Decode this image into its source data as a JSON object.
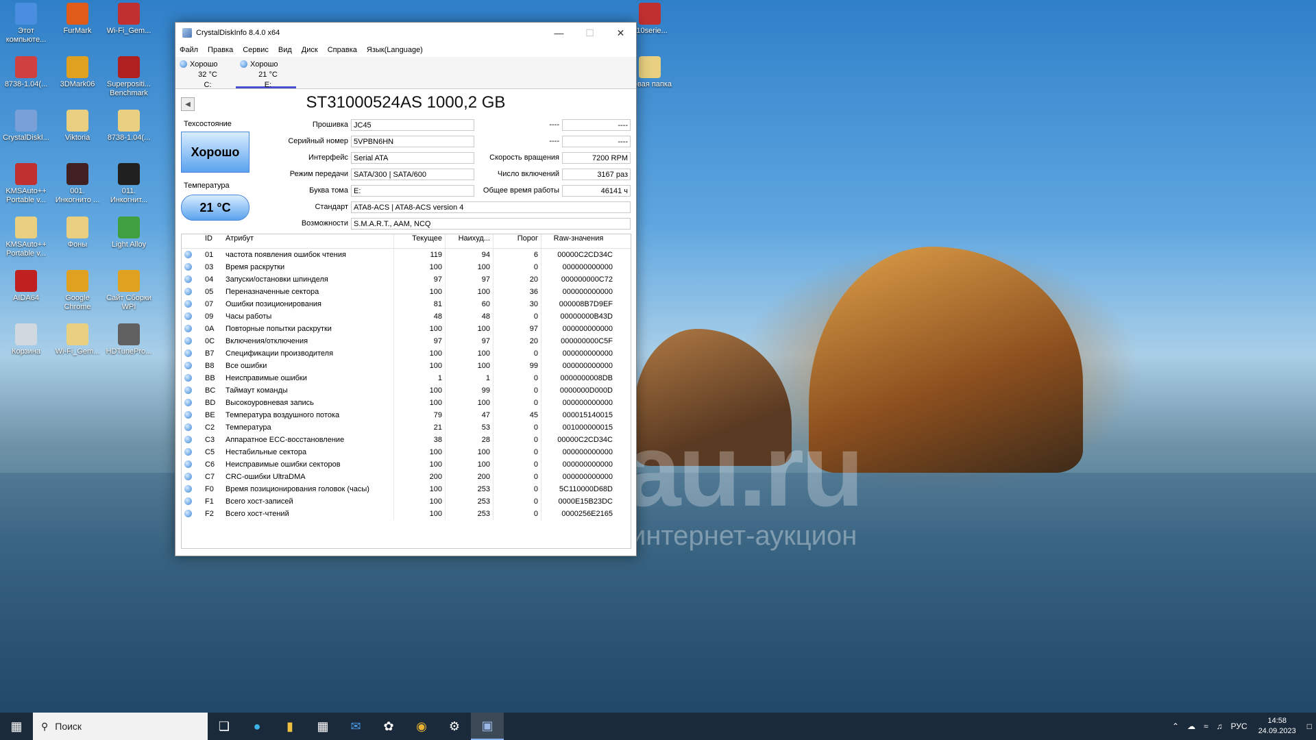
{
  "desktop": {
    "icons": [
      {
        "label": "Этот компьюте...",
        "color": "#4a8ee0"
      },
      {
        "label": "FurMark",
        "color": "#e05a1a"
      },
      {
        "label": "Wi-Fi_Gem...",
        "color": "#c03030"
      },
      {
        "label": "8738-1.04(...",
        "color": "#d04040"
      },
      {
        "label": "3DMark06",
        "color": "#e0a020"
      },
      {
        "label": "Superpositi... Benchmark",
        "color": "#b02020"
      },
      {
        "label": "CrystalDiskI...",
        "color": "#7aa0d8"
      },
      {
        "label": "Viktoria",
        "color": "#e8d080"
      },
      {
        "label": "8738-1.04(...",
        "color": "#e8d080"
      },
      {
        "label": "KMSAuto++ Portable v...",
        "color": "#c03030"
      },
      {
        "label": "001. Инкогнито ...",
        "color": "#402020"
      },
      {
        "label": "011. Инкогнит...",
        "color": "#202020"
      },
      {
        "label": "KMSAuto++ Portable v...",
        "color": "#e8d080"
      },
      {
        "label": "Фоны",
        "color": "#e8d080"
      },
      {
        "label": "Light Alloy",
        "color": "#40a040"
      },
      {
        "label": "AIDA64",
        "color": "#c02020"
      },
      {
        "label": "Google Chrome",
        "color": "#e0a020"
      },
      {
        "label": "Сайт Сборки WPI",
        "color": "#e0a020"
      },
      {
        "label": "Корзина",
        "color": "#d0d8e0"
      },
      {
        "label": "Wi-Fi_Gem...",
        "color": "#e8d080"
      },
      {
        "label": "HDTunePro...",
        "color": "#606060"
      }
    ],
    "right_icons": [
      {
        "label": "010serie...",
        "color": "#c03030"
      },
      {
        "label": "Новая папка",
        "color": "#e8d080"
      }
    ],
    "watermark": "au.ru",
    "watermark_sub": "интернет-аукцион"
  },
  "window": {
    "title": "CrystalDiskInfo 8.4.0 x64",
    "menu": [
      "Файл",
      "Правка",
      "Сервис",
      "Вид",
      "Диск",
      "Справка",
      "Язык(Language)"
    ],
    "drives": [
      {
        "status": "Хорошо",
        "temp": "32 °C",
        "letter": "C:"
      },
      {
        "status": "Хорошо",
        "temp": "21 °C",
        "letter": "E:"
      }
    ],
    "model": "ST31000524AS 1000,2 GB",
    "health_label": "Техсостояние",
    "health_value": "Хорошо",
    "temp_label": "Температура",
    "temp_value": "21 °C",
    "fields": {
      "firmware_label": "Прошивка",
      "firmware": "JC45",
      "serial_label": "Серийный номер",
      "serial": "5VPBN6HN",
      "interface_label": "Интерфейс",
      "interface": "Serial ATA",
      "transfer_label": "Режим передачи",
      "transfer": "SATA/300 | SATA/600",
      "letter_label": "Буква тома",
      "letter": "E:",
      "standard_label": "Стандарт",
      "standard": "ATA8-ACS | ATA8-ACS version 4",
      "features_label": "Возможности",
      "features": "S.M.A.R.T., AAM, NCQ",
      "r1_label": "----",
      "r1": "----",
      "r2_label": "----",
      "r2": "----",
      "rpm_label": "Скорость вращения",
      "rpm": "7200 RPM",
      "power_count_label": "Число включений",
      "power_count": "3167 раз",
      "power_hours_label": "Общее время работы",
      "power_hours": "46141 ч"
    },
    "table_headers": [
      "ID",
      "Атрибут",
      "Текущее",
      "Наихуд...",
      "Порог",
      "Raw-значения"
    ],
    "attributes": [
      [
        "01",
        "частота появления ошибок чтения",
        "119",
        "94",
        "6",
        "00000C2CD34C"
      ],
      [
        "03",
        "Время раскрутки",
        "100",
        "100",
        "0",
        "000000000000"
      ],
      [
        "04",
        "Запуски/остановки шпинделя",
        "97",
        "97",
        "20",
        "000000000C72"
      ],
      [
        "05",
        "Переназначенные сектора",
        "100",
        "100",
        "36",
        "000000000000"
      ],
      [
        "07",
        "Ошибки позиционирования",
        "81",
        "60",
        "30",
        "000008B7D9EF"
      ],
      [
        "09",
        "Часы работы",
        "48",
        "48",
        "0",
        "00000000B43D"
      ],
      [
        "0A",
        "Повторные попытки раскрутки",
        "100",
        "100",
        "97",
        "000000000000"
      ],
      [
        "0C",
        "Включения/отключения",
        "97",
        "97",
        "20",
        "000000000C5F"
      ],
      [
        "B7",
        "Спецификации производителя",
        "100",
        "100",
        "0",
        "000000000000"
      ],
      [
        "B8",
        "Все ошибки",
        "100",
        "100",
        "99",
        "000000000000"
      ],
      [
        "BB",
        "Неисправимые ошибки",
        "1",
        "1",
        "0",
        "0000000008DB"
      ],
      [
        "BC",
        "Таймаут команды",
        "100",
        "99",
        "0",
        "0000000D000D"
      ],
      [
        "BD",
        "Высокоуровневая запись",
        "100",
        "100",
        "0",
        "000000000000"
      ],
      [
        "BE",
        "Температура воздушного потока",
        "79",
        "47",
        "45",
        "000015140015"
      ],
      [
        "C2",
        "Температура",
        "21",
        "53",
        "0",
        "001000000015"
      ],
      [
        "C3",
        "Аппаратное ECC-восстановление",
        "38",
        "28",
        "0",
        "00000C2CD34C"
      ],
      [
        "C5",
        "Нестабильные сектора",
        "100",
        "100",
        "0",
        "000000000000"
      ],
      [
        "C6",
        "Неисправимые ошибки секторов",
        "100",
        "100",
        "0",
        "000000000000"
      ],
      [
        "C7",
        "CRC-ошибки UltraDMA",
        "200",
        "200",
        "0",
        "000000000000"
      ],
      [
        "F0",
        "Время позиционирования головок (часы)",
        "100",
        "253",
        "0",
        "5C110000D68D"
      ],
      [
        "F1",
        "Всего хост-записей",
        "100",
        "253",
        "0",
        "0000E15B23DC"
      ],
      [
        "F2",
        "Всего хост-чтений",
        "100",
        "253",
        "0",
        "0000256E2165"
      ]
    ]
  },
  "taskbar": {
    "search_placeholder": "Поиск",
    "lang": "РУС",
    "time": "14:58",
    "date": "24.09.2023"
  }
}
